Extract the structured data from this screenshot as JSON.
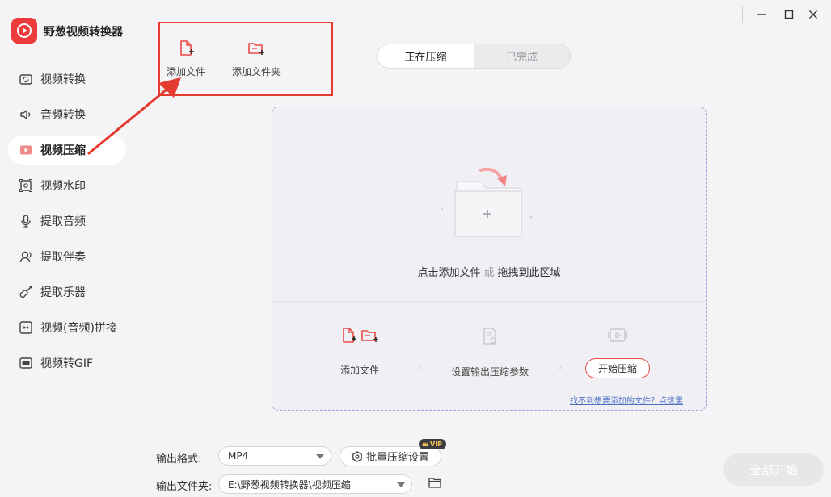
{
  "app": {
    "title": "野葱视频转换器"
  },
  "colors": {
    "accent": "#ee3b3b",
    "highlight_box": "#e53a2f",
    "link": "#4a6cc5"
  },
  "sidebar": {
    "items": [
      {
        "label": "视频转换",
        "icon": "video-convert-icon",
        "active": false
      },
      {
        "label": "音频转换",
        "icon": "speaker-icon",
        "active": false
      },
      {
        "label": "视频压缩",
        "icon": "video-compress-icon",
        "active": true
      },
      {
        "label": "视频水印",
        "icon": "watermark-icon",
        "active": false
      },
      {
        "label": "提取音频",
        "icon": "microphone-icon",
        "active": false
      },
      {
        "label": "提取伴奏",
        "icon": "headphone-icon",
        "active": false
      },
      {
        "label": "提取乐器",
        "icon": "guitar-icon",
        "active": false
      },
      {
        "label": "视频(音频)拼接",
        "icon": "merge-icon",
        "active": false
      },
      {
        "label": "视频转GIF",
        "icon": "gif-icon",
        "active": false
      }
    ]
  },
  "toolbar": {
    "add_file": "添加文件",
    "add_folder": "添加文件夹"
  },
  "tabs": [
    {
      "label": "正在压缩",
      "active": true
    },
    {
      "label": "已完成",
      "active": false
    }
  ],
  "dropzone": {
    "prompt_main": "点击添加文件",
    "prompt_or": "或",
    "prompt_drag": "拖拽到此区域",
    "step1": "添加文件",
    "step2": "设置输出压缩参数",
    "step3_button": "开始压缩",
    "help_link": "找不到想要添加的文件？点这里"
  },
  "settings": {
    "format_label": "输出格式:",
    "format_value": "MP4",
    "batch_button": "批量压缩设置",
    "vip_badge": "VIP",
    "folder_label": "输出文件夹:",
    "folder_value": "E:\\野葱视频转换器\\视频压缩"
  },
  "start_all": "全部开始"
}
